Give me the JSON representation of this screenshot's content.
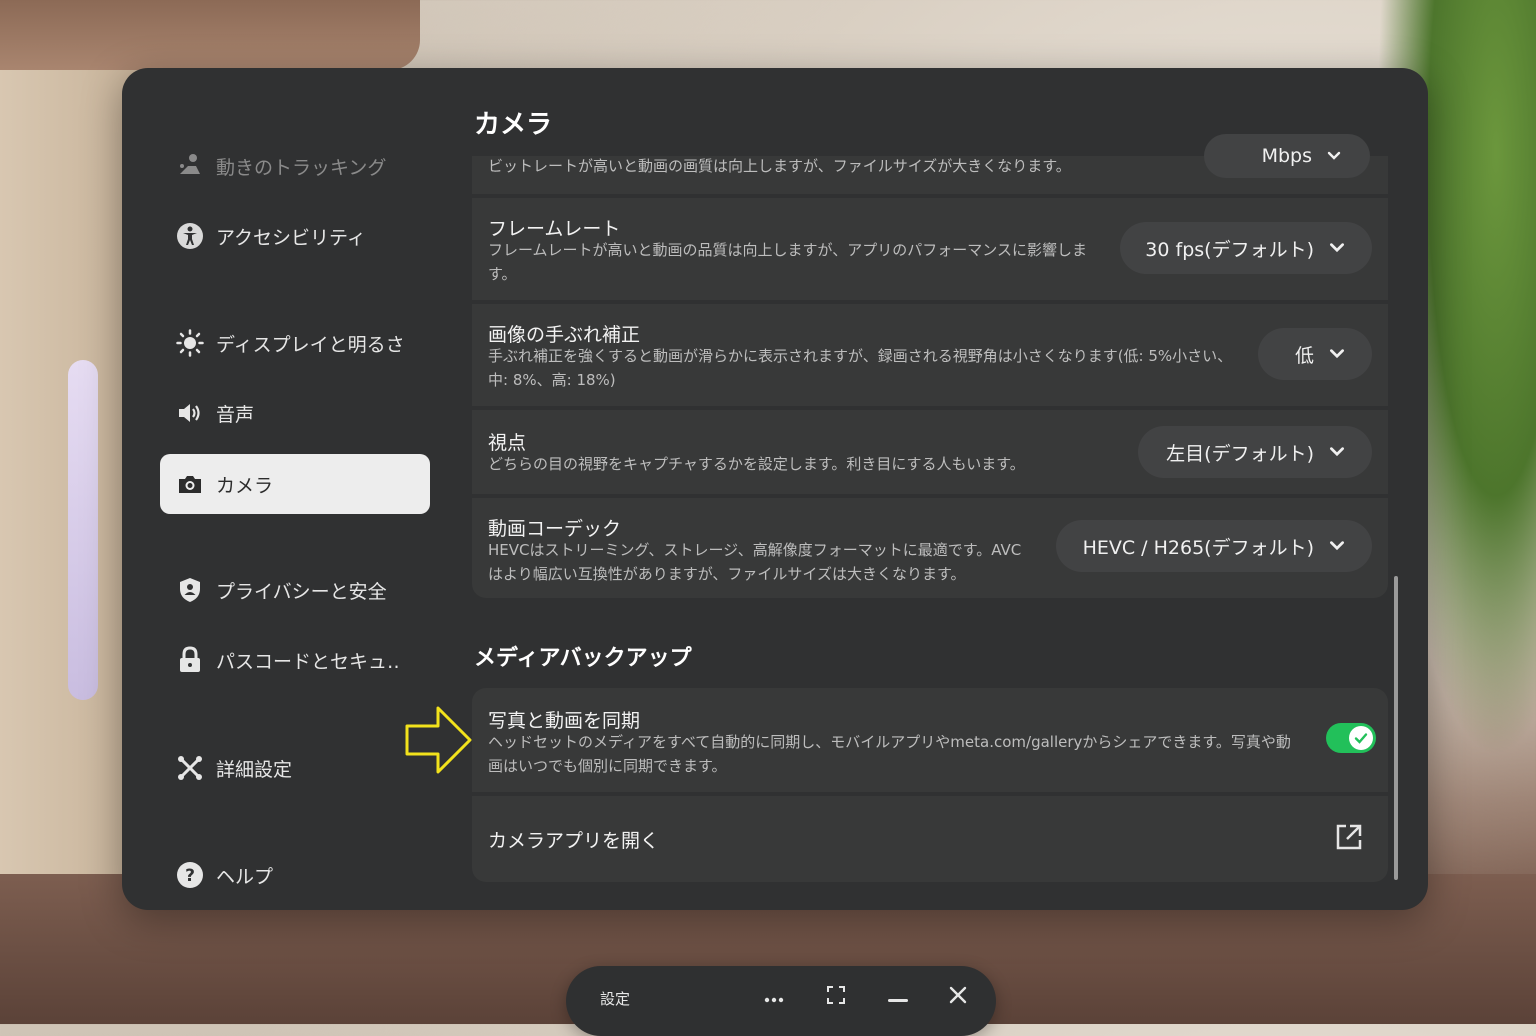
{
  "sidebar": {
    "items": [
      {
        "label": "動きのトラッキング",
        "icon": "person-tracking-icon"
      },
      {
        "label": "アクセシビリティ",
        "icon": "accessibility-icon"
      },
      {
        "label": "ディスプレイと明るさ",
        "icon": "brightness-icon"
      },
      {
        "label": "音声",
        "icon": "speaker-icon"
      },
      {
        "label": "カメラ",
        "icon": "camera-icon",
        "active": true
      },
      {
        "label": "プライバシーと安全",
        "icon": "shield-icon"
      },
      {
        "label": "パスコードとセキュ‥",
        "icon": "lock-icon"
      },
      {
        "label": "詳細設定",
        "icon": "advanced-settings-icon"
      },
      {
        "label": "ヘルプ",
        "icon": "help-icon"
      }
    ]
  },
  "camera_section": {
    "title": "カメラ",
    "bitrate": {
      "desc": "ビットレートが高いと動画の画質は向上しますが、ファイルサイズが大きくなります。",
      "value": "Mbps"
    },
    "frame_rate": {
      "title": "フレームレート",
      "desc_line1": "フレームレートが高いと動画の品質は向上しますが、アプリのパフォーマンスに影響しま",
      "desc_line2": "す。",
      "value": "30 fps(デフォルト)"
    },
    "stabilization": {
      "title": "画像の手ぶれ補正",
      "desc_line1": "手ぶれ補正を強くすると動画が滑らかに表示されますが、録画される視野角は小さくなります(低: 5%小さい、",
      "desc_line2": "中: 8%、高: 18%)",
      "value": "低"
    },
    "viewpoint": {
      "title": "視点",
      "desc": "どちらの目の視野をキャプチャするかを設定します。利き目にする人もいます。",
      "value": "左目(デフォルト)"
    },
    "codec": {
      "title": "動画コーデック",
      "desc_line1": "HEVCはストリーミング、ストレージ、高解像度フォーマットに最適です。AVC",
      "desc_line2": "はより幅広い互換性がありますが、ファイルサイズは大きくなります。",
      "value": "HEVC / H265(デフォルト)"
    }
  },
  "backup_section": {
    "title": "メディアバックアップ",
    "sync": {
      "title": "写真と動画を同期",
      "desc_line1": "ヘッドセットのメディアをすべて自動的に同期し、モバイルアプリやmeta.com/galleryからシェアできます。写真や動",
      "desc_line2": "画はいつでも個別に同期できます。",
      "enabled": true
    },
    "open_camera_app": {
      "label": "カメラアプリを開く"
    }
  },
  "taskbar": {
    "title": "設定"
  },
  "colors": {
    "toggle_on": "#22c05a",
    "annotation_arrow": "#f2e21c",
    "panel_bg": "#303132"
  }
}
